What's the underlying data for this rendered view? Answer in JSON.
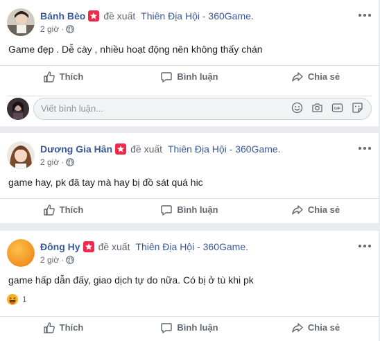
{
  "posts": [
    {
      "author": "Bánh Bèo",
      "verb": "đề xuất",
      "page": "Thiên Địa Hội - 360Game.",
      "time": "2 giờ",
      "text": "Game đẹp . Dễ cày , nhiều hoạt động nên không thấy chán"
    },
    {
      "author": "Dương Gia Hân",
      "verb": "đề xuất",
      "page": "Thiên Địa Hội - 360Game.",
      "time": "2 giờ",
      "text": "game hay, pk đã tay mà hay bị đồ sát quá hic"
    },
    {
      "author": "Đông Hy",
      "verb": "đề xuất",
      "page": "Thiên Địa Hội - 360Game.",
      "time": "2 giờ",
      "text": "game hấp dẫn đấy, giao dịch tự do nữa. Có bị ở tù khi pk",
      "reaction_count": "1",
      "reaction_icon": "haha-emoji-icon"
    }
  ],
  "actions": {
    "like": "Thích",
    "comment": "Bình luận",
    "share": "Chia sẻ"
  },
  "comment_box": {
    "placeholder": "Viết bình luận...",
    "icons": [
      "emoji-icon",
      "camera-icon",
      "gif-icon",
      "sticker-icon"
    ]
  },
  "colors": {
    "link": "#385898",
    "badge": "#f02849",
    "muted": "#606770",
    "background": "#e9ebee"
  }
}
